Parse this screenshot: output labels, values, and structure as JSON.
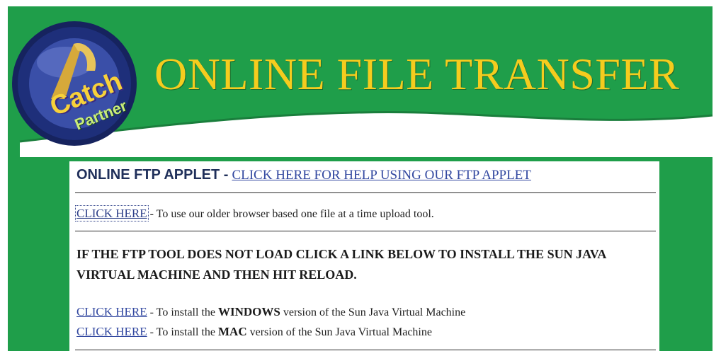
{
  "banner": {
    "title": "ONLINE FILE TRANSFER",
    "logo": {
      "brand_word": "Catch",
      "brand_sub": "Partner"
    }
  },
  "applet_row": {
    "heading": "ONLINE FTP APPLET -",
    "help_link": "CLICK HERE FOR HELP USING OUR FTP APPLET"
  },
  "older_tool_row": {
    "link": "CLICK HERE",
    "text": " - To use our older browser based one file at a time upload tool."
  },
  "notice": {
    "text": "IF THE FTP TOOL DOES NOT LOAD CLICK A LINK BELOW TO INSTALL THE SUN JAVA VIRTUAL MACHINE AND THEN HIT RELOAD."
  },
  "install_links": {
    "windows": {
      "link": "CLICK HERE",
      "before": " - To install the ",
      "platform": "WINDOWS",
      "after": " version of the Sun Java Virtual Machine"
    },
    "mac": {
      "link": "CLICK HERE",
      "before": " - To install the ",
      "platform": "MAC",
      "after": " version of the Sun Java Virtual Machine"
    }
  },
  "colors": {
    "banner_green": "#1f9e4a",
    "title_gold": "#f5cc1e",
    "link_blue": "#3248a0",
    "logo_navy": "#1e2f7a"
  },
  "icons": [
    "logo-badge-icon"
  ]
}
